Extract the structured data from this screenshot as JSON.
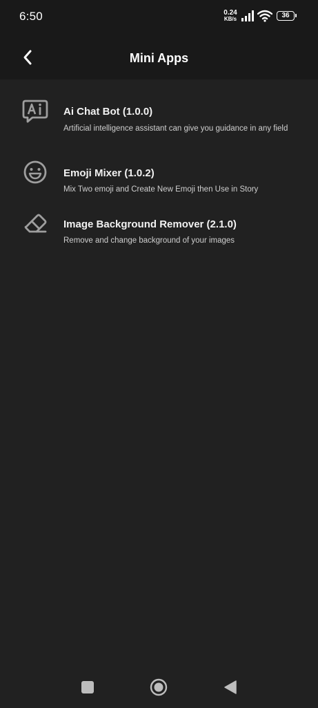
{
  "status_bar": {
    "time": "6:50",
    "net_speed_value": "0.24",
    "net_speed_unit": "KB/s",
    "battery": "36",
    "icons": [
      "signal-icon",
      "wifi-icon",
      "battery-icon"
    ]
  },
  "header": {
    "title": "Mini Apps",
    "back_icon": "chevron-left-icon"
  },
  "apps": [
    {
      "icon": "ai-chat-icon",
      "title": "Ai Chat Bot (1.0.0)",
      "description": "Artificial intelligence assistant can give you guidance in any field"
    },
    {
      "icon": "smiley-icon",
      "title": "Emoji Mixer (1.0.2)",
      "description": "Mix Two emoji and Create New Emoji then Use in Story"
    },
    {
      "icon": "eraser-icon",
      "title": "Image Background Remover (2.1.0)",
      "description": "Remove and change background of your images"
    }
  ],
  "nav_bar": {
    "icons": [
      "recents-square-icon",
      "home-circle-icon",
      "back-triangle-icon"
    ]
  },
  "colors": {
    "background": "#212121",
    "bar": "#191919",
    "icon": "#9e9e9e",
    "text_primary": "#f2f2f2",
    "text_secondary": "#cfcfcf"
  }
}
